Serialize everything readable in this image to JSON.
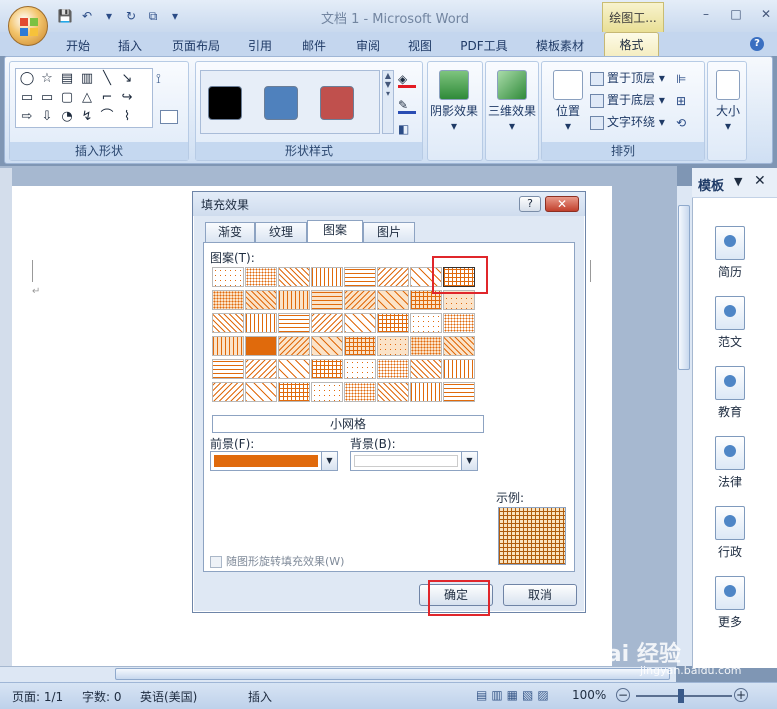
{
  "app": {
    "title": "文档 1 - Microsoft Word",
    "context_tab_title": "绘图工...",
    "window_controls": [
      "–",
      "□",
      "✕"
    ]
  },
  "quick_access": [
    "💾",
    "↶",
    "▾",
    "↻",
    "⧉",
    "▾"
  ],
  "tabs": [
    "开始",
    "插入",
    "页面布局",
    "引用",
    "邮件",
    "审阅",
    "视图",
    "PDF工具",
    "模板素材",
    "格式"
  ],
  "ribbon": {
    "insert_shapes": {
      "label": "插入形状",
      "shapes": [
        "◯",
        "☆",
        "▤",
        "▥",
        "╲",
        "↘",
        "▭",
        "▭",
        "▢",
        "△",
        "⌐",
        "↪",
        "⇨",
        "⇩",
        "◔",
        "↯",
        "⌒",
        "⌇"
      ]
    },
    "shape_styles": {
      "label": "形状样式",
      "swatches": [
        "#000000",
        "#4f81bd",
        "#c0504d"
      ]
    },
    "shadow_effects": {
      "label": "阴影效果"
    },
    "3d_effects": {
      "label": "三维效果"
    },
    "arrange": {
      "label": "排列",
      "position": "位置",
      "bring_front": "置于顶层",
      "send_back": "置于底层",
      "text_wrap": "文字环绕"
    },
    "size": {
      "label": "大小"
    }
  },
  "dialog": {
    "title": "填充效果",
    "help": "?",
    "close": "✕",
    "tabs": [
      "渐变",
      "纹理",
      "图案",
      "图片"
    ],
    "active_tab": "图案",
    "pattern_label": "图案(T):",
    "selected_pattern": "小网格",
    "foreground_label": "前景(F):",
    "foreground_color": "#e06a0c",
    "background_label": "背景(B):",
    "background_color": "#ffffff",
    "sample_label": "示例:",
    "rotate_label": "随图形旋转填充效果(W)",
    "ok": "确定",
    "cancel": "取消",
    "pattern_color": "#e06a0c",
    "grid": {
      "columns": 8,
      "rows": 6,
      "selected_index": 7
    }
  },
  "taskpane": {
    "title": "模板",
    "items": [
      "简历",
      "范文",
      "教育",
      "法律",
      "行政",
      "更多"
    ]
  },
  "status": {
    "page": "页面: 1/1",
    "words": "字数: 0",
    "language": "英语(美国)",
    "mode": "插入",
    "zoom": "100%"
  },
  "watermark": {
    "text": "Bai 经验",
    "url": "jingyan.baidu.com"
  }
}
